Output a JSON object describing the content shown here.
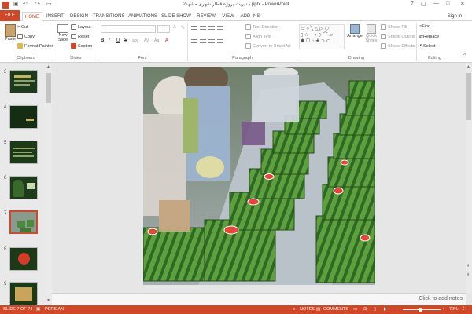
{
  "titlebar": {
    "title": "مدیریت پروژه قطار شهری مشهد2.pptx - PowerPoint",
    "signin": "Sign in"
  },
  "tabs": [
    "FILE",
    "HOME",
    "INSERT",
    "DESIGN",
    "TRANSITIONS",
    "ANIMATIONS",
    "SLIDE SHOW",
    "REVIEW",
    "VIEW",
    "ADD-INS"
  ],
  "ribbon": {
    "clipboard": {
      "paste": "Paste",
      "cut": "Cut",
      "copy": "Copy",
      "format_painter": "Format Painter",
      "label": "Clipboard"
    },
    "slides": {
      "new_slide": "New Slide",
      "layout": "Layout",
      "reset": "Reset",
      "section": "Section",
      "label": "Slides"
    },
    "font": {
      "label": "Font",
      "bold": "B",
      "italic": "I",
      "underline": "U",
      "strike": "S",
      "shadow": "abc",
      "spacing": "AV",
      "case": "Aa",
      "color": "A"
    },
    "paragraph": {
      "text_direction": "Text Direction",
      "align_text": "Align Text",
      "convert": "Convert to SmartArt",
      "label": "Paragraph"
    },
    "drawing": {
      "arrange": "Arrange",
      "quick_styles": "Quick Styles",
      "shape_fill": "Shape Fill",
      "shape_outline": "Shape Outline",
      "shape_effects": "Shape Effects",
      "label": "Drawing"
    },
    "editing": {
      "find": "Find",
      "replace": "Replace",
      "select": "Select",
      "label": "Editing"
    }
  },
  "thumbnails": [
    {
      "num": "3"
    },
    {
      "num": "4"
    },
    {
      "num": "5"
    },
    {
      "num": "6"
    },
    {
      "num": "7"
    },
    {
      "num": "8"
    },
    {
      "num": "9"
    }
  ],
  "notes": {
    "placeholder": "Click to add notes"
  },
  "status": {
    "slide": "SLIDE 7 OF 74",
    "language": "PERSIAN",
    "notes": "NOTES",
    "comments": "COMMENTS",
    "zoom": "70%"
  },
  "colors": {
    "accent": "#d24726",
    "melon": "#4a8a3a"
  }
}
